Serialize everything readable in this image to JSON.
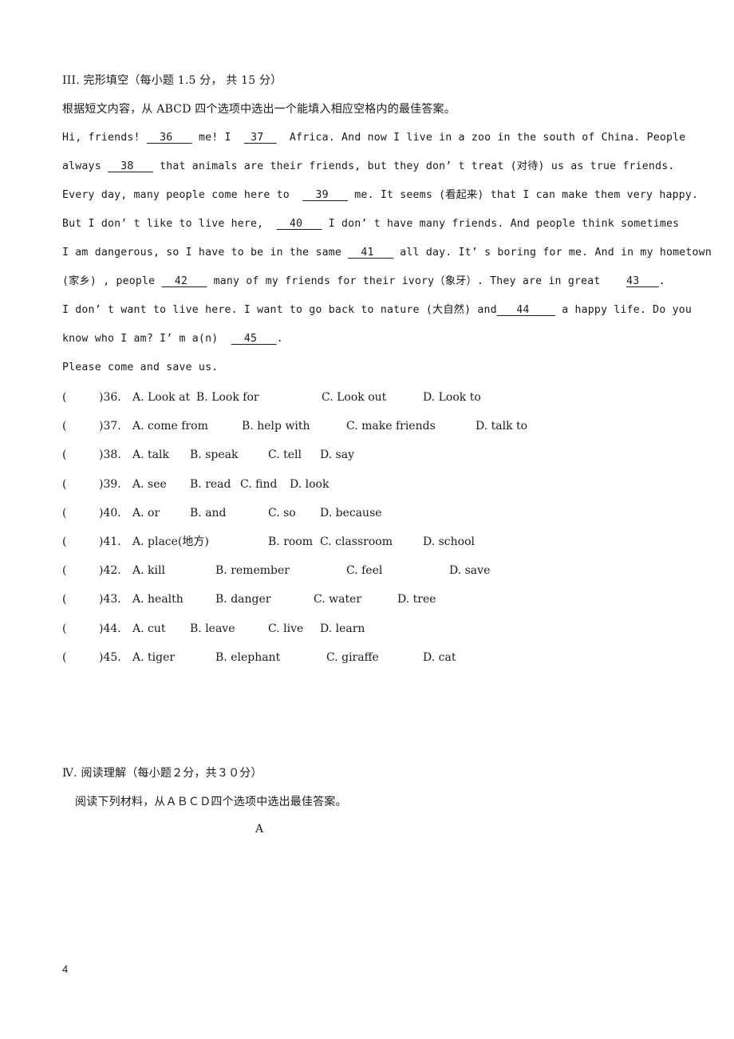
{
  "section3": {
    "title": "III. 完形填空（每小题 1.5 分， 共 15 分）",
    "instruction": "根据短文内容，从 ABCD 四个选项中选出一个能填入相应空格内的最佳答案。",
    "passage_lines": [
      [
        {
          "t": "Hi, friends! "
        },
        {
          "b": "  36   "
        },
        {
          "t": " me! I  "
        },
        {
          "b": " 37  "
        },
        {
          "t": "  Africa. And now I live in a zoo in the south of China. People"
        }
      ],
      [
        {
          "t": "always "
        },
        {
          "b": "  38   "
        },
        {
          "t": " that animals are their friends, but they don’ t treat (对待) us as true friends."
        }
      ],
      [
        {
          "t": "Every day, many people come here to  "
        },
        {
          "b": "  39   "
        },
        {
          "t": " me. It seems (看起来) that I can make them very happy."
        }
      ],
      [
        {
          "t": "But I don’ t like to live here,  "
        },
        {
          "b": "  40   "
        },
        {
          "t": " I don’ t have many friends. And people think sometimes"
        }
      ],
      [
        {
          "t": "I am dangerous, so I have to be in the same "
        },
        {
          "b": "  41   "
        },
        {
          "t": " all day. It’ s boring for me. And in my hometown"
        }
      ],
      [
        {
          "t": "(家乡) , people "
        },
        {
          "b": "  42   "
        },
        {
          "t": " many of my friends for their ivory（象牙）. They are in great    "
        },
        {
          "b": "43   "
        },
        {
          "t": "."
        }
      ],
      [
        {
          "t": "I don’ t want to live here. I want to go back to nature (大自然) and"
        },
        {
          "b": "   44    "
        },
        {
          "t": " a happy life. Do you"
        }
      ],
      [
        {
          "t": "know who I am? I’ m a(n)  "
        },
        {
          "b": "  45   "
        },
        {
          "t": "."
        }
      ],
      [
        {
          "t": "Please come and save us."
        }
      ]
    ],
    "questions": [
      {
        "num": ")36.",
        "options": [
          "A. Look at",
          "B. Look for",
          "C. Look out",
          "D. Look to"
        ]
      },
      {
        "num": ")37.",
        "options": [
          "A. come from",
          "B. help with",
          "C. make friends",
          "D. talk to"
        ]
      },
      {
        "num": ")38.",
        "options": [
          "A. talk",
          "B. speak",
          "C. tell",
          "D. say"
        ]
      },
      {
        "num": ")39.",
        "options": [
          "A. see",
          "B. read",
          "C. find",
          "D. look"
        ]
      },
      {
        "num": ")40.",
        "options": [
          "A. or",
          "B. and",
          "C. so",
          "D. because"
        ]
      },
      {
        "num": ")41.",
        "options": [
          "A. place(地方)",
          "B. room",
          "C. classroom",
          "D. school"
        ]
      },
      {
        "num": ")42.",
        "options": [
          "A. kill",
          "B. remember",
          "C. feel",
          "D. save"
        ]
      },
      {
        "num": ")43.",
        "options": [
          "A. health",
          "B. danger",
          "C. water",
          "D. tree"
        ]
      },
      {
        "num": ")44.",
        "options": [
          "A. cut",
          "B. leave",
          "C. live",
          "D. learn"
        ]
      },
      {
        "num": ")45.",
        "options": [
          "A. tiger",
          "B. elephant",
          "C. giraffe",
          "D. cat"
        ]
      }
    ],
    "answer_paren": "("
  },
  "section4": {
    "title": "Ⅳ. 阅读理解（每小题２分，共３０分）",
    "instruction": "阅读下列材料，从ＡＢＣＤ四个选项中选出最佳答案。",
    "passage_label": "A"
  },
  "page_number": "4"
}
